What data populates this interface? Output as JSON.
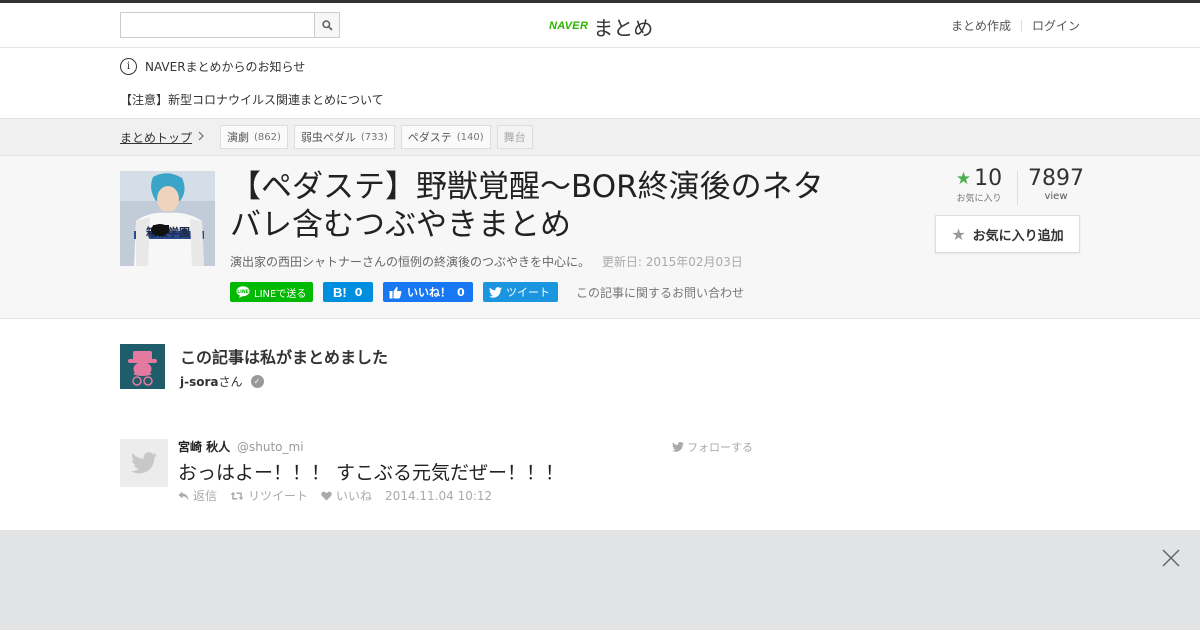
{
  "header": {
    "search": {
      "value": "",
      "placeholder": ""
    },
    "logo": {
      "brand": "NAVER",
      "service": "まとめ"
    },
    "links": {
      "create": "まとめ作成",
      "login": "ログイン"
    }
  },
  "notices": {
    "heading": "NAVERまとめからのお知らせ",
    "item": "【注意】新型コロナウイルス関連まとめについて"
  },
  "breadcrumb": {
    "top": "まとめトップ",
    "tags": [
      {
        "label": "演劇",
        "count": "(862)"
      },
      {
        "label": "弱虫ペダル",
        "count": "(733)"
      },
      {
        "label": "ペダステ",
        "count": "(140)"
      },
      {
        "label": "舞台",
        "count": ""
      }
    ]
  },
  "article": {
    "title": "【ペダステ】野獣覚醒～BOR終演後のネタバレ含むつぶやきまとめ",
    "description": "演出家の西田シャトナーさんの恒例の終演後のつぶやきを中心に。",
    "updated": "更新日: 2015年02月03日",
    "favorites": {
      "count": "10",
      "label": "お気に入り"
    },
    "views": {
      "count": "7897",
      "label": "view"
    },
    "fav_button": "お気に入り追加",
    "share": {
      "line": "LINEで送る",
      "hatena_count": "0",
      "like_label": "いいね！",
      "like_count": "0",
      "tweet": "ツイート"
    },
    "contact": "この記事に関するお問い合わせ"
  },
  "author": {
    "heading": "この記事は私がまとめました",
    "name": "j-sora",
    "suffix": "さん"
  },
  "tweet": {
    "name": "宮崎 秋人",
    "handle": "@shuto_mi",
    "follow": "フォローする",
    "text": "おっはよー！！！ すこぶる元気だぜー！！！",
    "reply": "返信",
    "retweet": "リツイート",
    "like": "いいね",
    "date": "2014.11.04 10:12"
  },
  "colors": {
    "naver_green": "#2db400",
    "line_green": "#00b900",
    "hatena_blue": "#008fde",
    "facebook_blue": "#1877f2",
    "twitter_blue": "#1b95e0",
    "star_green": "#4caf50"
  }
}
